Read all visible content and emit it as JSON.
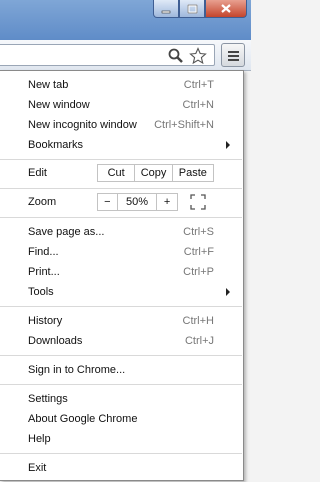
{
  "window": {
    "buttons": [
      "minimize",
      "maximize",
      "close"
    ]
  },
  "toolbar": {
    "icons": [
      "zoom-icon",
      "star-icon"
    ],
    "menu_icon": "hamburger-icon"
  },
  "menu": {
    "new_tab": {
      "label": "New tab",
      "shortcut": "Ctrl+T"
    },
    "new_window": {
      "label": "New window",
      "shortcut": "Ctrl+N"
    },
    "new_incognito": {
      "label": "New incognito window",
      "shortcut": "Ctrl+Shift+N"
    },
    "bookmarks": {
      "label": "Bookmarks"
    },
    "edit": {
      "label": "Edit",
      "cut": "Cut",
      "copy": "Copy",
      "paste": "Paste"
    },
    "zoom": {
      "label": "Zoom",
      "minus": "−",
      "value": "50%",
      "plus": "+"
    },
    "save_page": {
      "label": "Save page as...",
      "shortcut": "Ctrl+S"
    },
    "find": {
      "label": "Find...",
      "shortcut": "Ctrl+F"
    },
    "print": {
      "label": "Print...",
      "shortcut": "Ctrl+P"
    },
    "tools": {
      "label": "Tools"
    },
    "history": {
      "label": "History",
      "shortcut": "Ctrl+H"
    },
    "downloads": {
      "label": "Downloads",
      "shortcut": "Ctrl+J"
    },
    "sign_in": {
      "label": "Sign in to Chrome..."
    },
    "settings": {
      "label": "Settings"
    },
    "about": {
      "label": "About Google Chrome"
    },
    "help": {
      "label": "Help"
    },
    "exit": {
      "label": "Exit"
    }
  }
}
